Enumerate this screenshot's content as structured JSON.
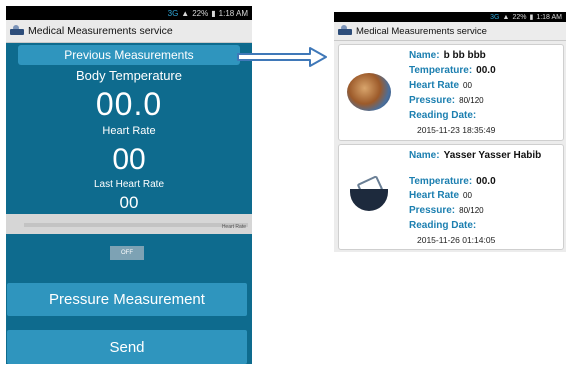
{
  "left_screen": {
    "status_bar": {
      "network": "3G",
      "battery": "22%",
      "time": "1:18 AM"
    },
    "app_title": "Medical Measurements service",
    "previous_button": "Previous Measurements",
    "body_temperature_label": "Body Temperature",
    "temperature_value": "00.0",
    "heart_rate_label": "Heart Rate",
    "heart_rate_value": "00",
    "last_heart_rate_label": "Last Heart Rate",
    "last_heart_rate_value": "00",
    "graph_label": "Heart Rate",
    "toggle_label": "OFF",
    "pressure_button": "Pressure Measurement",
    "send_button": "Send"
  },
  "right_screen": {
    "status_bar": {
      "network": "3G",
      "battery": "22%",
      "time": "1:18 AM"
    },
    "app_title": "Medical Measurements service",
    "records": [
      {
        "name_label": "Name:",
        "name": "b bb bbb",
        "temperature_label": "Temperature:",
        "temperature": "00.0",
        "heart_rate_label": "Heart Rate",
        "heart_rate": "00",
        "pressure_label": "Pressure:",
        "pressure": "80/120",
        "reading_date_label": "Reading Date:",
        "reading_date": "2015-11-23 18:35:49"
      },
      {
        "name_label": "Name:",
        "name": "Yasser Yasser Habib",
        "temperature_label": "Temperature:",
        "temperature": "00.0",
        "heart_rate_label": "Heart Rate",
        "heart_rate": "00",
        "pressure_label": "Pressure:",
        "pressure": "80/120",
        "reading_date_label": "Reading Date:",
        "reading_date": "2015-11-26 01:14:05"
      }
    ]
  },
  "colors": {
    "primary_background": "#0e6b8e",
    "button_blue": "#2f95be",
    "label_blue": "#1c7fb0",
    "arrow_blue": "#3f78b8"
  }
}
